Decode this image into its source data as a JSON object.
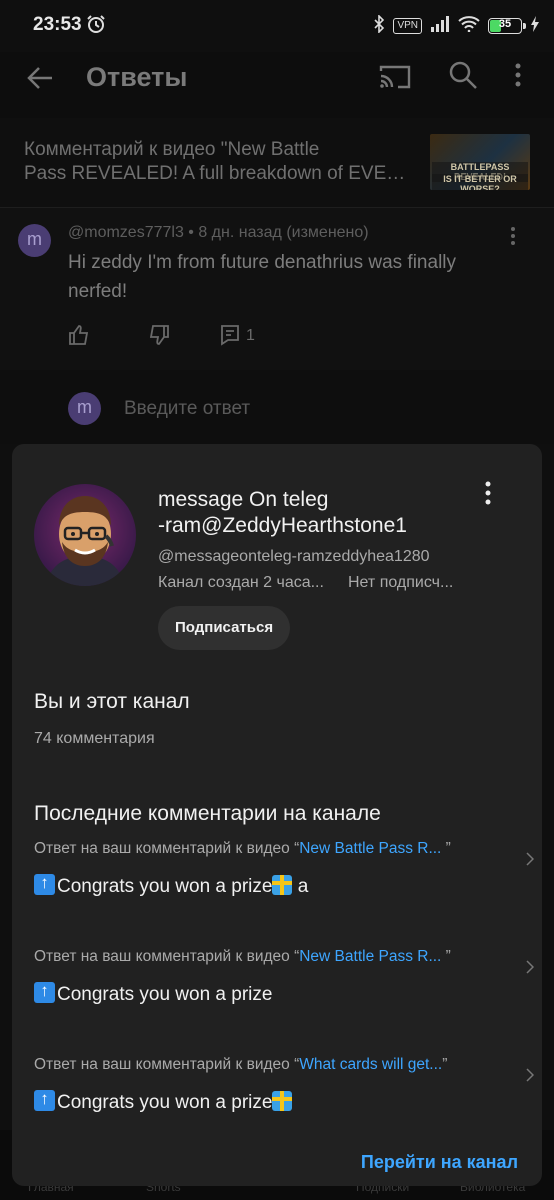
{
  "status_bar": {
    "time": "23:53",
    "vpn": "VPN",
    "battery": "35"
  },
  "app_bar": {
    "title": "Ответы"
  },
  "video_ref": {
    "line1": "Комментарий к видео \"New Battle",
    "line2": "Pass REVEALED! A full breakdown of EVER...",
    "thumb_line1": "BATTLEPASS REVEALED!",
    "thumb_line2": "IS IT BETTER OR WORSE?"
  },
  "comment": {
    "avatar_letter": "m",
    "meta": "@momzes777l3 • 8 дн. назад (изменено)",
    "text": "Hi zeddy I'm from future denathrius was finally nerfed!",
    "reply_count": "1"
  },
  "reply_input": {
    "avatar_letter": "m",
    "placeholder": "Введите ответ"
  },
  "bottom_nav": {
    "items": [
      "Главная",
      "Shorts",
      "",
      "Подписки",
      "Библиотека"
    ]
  },
  "channel_sheet": {
    "name_line1": "message On teleg",
    "name_line2": "-ram@ZeddyHearthstone1",
    "handle": "@messageonteleg-ramzeddyhea1280",
    "created": "Канал создан 2 часа...",
    "subscribers": "Нет подписч...",
    "subscribe_label": "Подписаться",
    "you_title": "Вы и этот канал",
    "you_count": "74 комментария",
    "recent_title": "Последние комментарии на канале",
    "recent": [
      {
        "prefix": "Ответ на ваш комментарий к видео “",
        "video": "New Battle Pass R...",
        "suffix": " ”",
        "text": "Congrats you won a prize",
        "tail": " a"
      },
      {
        "prefix": "Ответ на ваш комментарий к видео “",
        "video": "New Battle Pass R...",
        "suffix": " ”",
        "text": "Congrats you won a prize",
        "tail": ""
      },
      {
        "prefix": "Ответ на ваш комментарий к видео “",
        "video": "What cards will get...",
        "suffix": "”",
        "text": "Congrats you won a prize",
        "tail": ""
      }
    ],
    "goto_label": "Перейти на канал"
  },
  "colors": {
    "sheet_bg": "#212121",
    "link": "#3ea6ff",
    "avatar_purple": "#4a3d73"
  }
}
